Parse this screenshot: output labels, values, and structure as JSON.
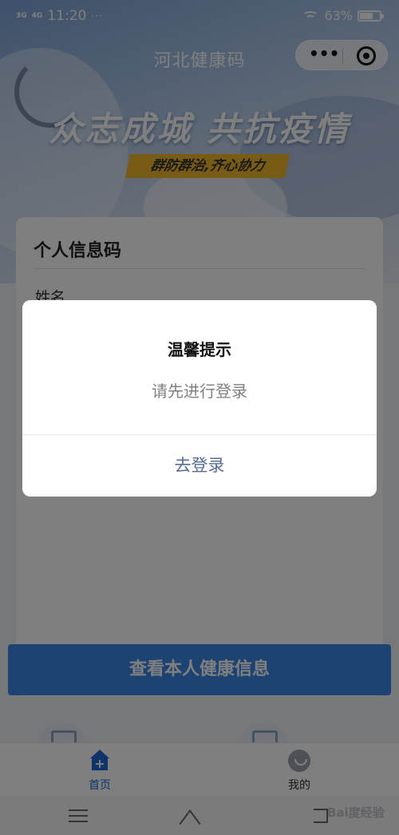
{
  "status_bar": {
    "signal_1": "3G",
    "signal_2": "4G",
    "time": "11:20",
    "more": "···",
    "battery": "63%",
    "battery_fraction": 0.63
  },
  "nav": {
    "title": "河北健康码",
    "more_icon": "ellipsis-icon",
    "close_icon": "target-close-icon"
  },
  "banner": {
    "slogan": "众志成城 共抗疫情",
    "subslogan": "群防群治,齐心协力"
  },
  "card": {
    "title": "个人信息码",
    "name_label": "姓名"
  },
  "main_button": "查看本人健康信息",
  "tabbar": {
    "items": [
      {
        "label": "首页",
        "icon": "home-plus-icon",
        "active": true
      },
      {
        "label": "我的",
        "icon": "user-smile-icon",
        "active": false
      }
    ]
  },
  "dialog": {
    "title": "温馨提示",
    "message": "请先进行登录",
    "confirm_label": "去登录"
  },
  "colors": {
    "accent": "#1e67d6",
    "button": "#3a86e6",
    "dialog_link": "#576b95",
    "banner_yellow": "#f1b728"
  }
}
